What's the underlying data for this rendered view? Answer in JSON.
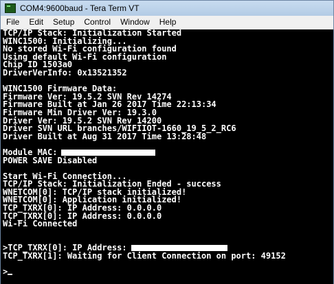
{
  "window": {
    "title": "COM4:9600baud - Tera Term VT"
  },
  "menu": {
    "items": [
      "File",
      "Edit",
      "Setup",
      "Control",
      "Window",
      "Help"
    ]
  },
  "terminal": {
    "lines": [
      "TCP/IP Stack: Initialization Started",
      "WINC1500: Initializing...",
      "No stored Wi-Fi configuration found",
      "Using default Wi-Fi configuration",
      "Chip ID 1503a0",
      "DriverVerInfo: 0x13521352",
      "",
      "WINC1500 Firmware Data:",
      "Firmware Ver: 19.5.2 SVN Rev 14274",
      "Firmware Built at Jan 26 2017 Time 22:13:34",
      "Firmware Min Driver Ver: 19.3.0",
      "Driver Ver: 19.5.2 SVN Rev 14200",
      "Driver SVN URL branches/WIFIIOT-1660_19_5_2_RC6",
      "Driver Built at Aug 31 2017 Time 13:28:48",
      "",
      "Module MAC:",
      "POWER SAVE Disabled",
      "",
      "Start Wi-Fi Connection...",
      "TCP/IP Stack: Initialization Ended - success",
      "WNETCOM[0]: TCP/IP stack initialized!",
      "WNETCOM[0]: Application initialized!",
      "TCP_TXRX[0]: IP Address: 0.0.0.0",
      "TCP_TXRX[0]: IP Address: 0.0.0.0",
      "Wi-Fi Connected",
      "",
      "",
      ">TCP_TXRX[0]: IP Address:",
      "TCP_TXRX[1]: Waiting for Client Connection on port: 49152",
      "",
      ">"
    ]
  }
}
